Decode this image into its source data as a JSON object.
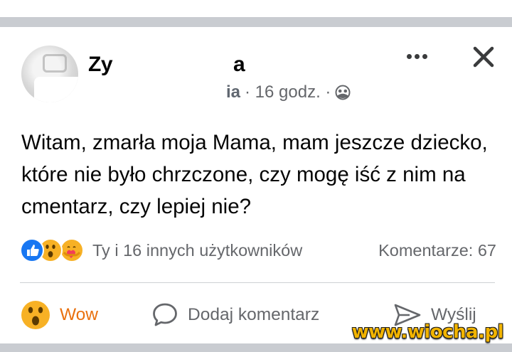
{
  "post": {
    "author_visible_fragment_left": "Zy",
    "author_visible_fragment_right": "a",
    "meta_fragment": "ia",
    "time": "· 16 godz. ·",
    "audience_icon": "group-icon",
    "text": "Witam, zmarła moja Mama, mam jeszcze dziecko, które nie było chrzczone, czy mogę iść z nim na cmentarz, czy lepiej nie?"
  },
  "header": {
    "more_icon": "more-dots-icon",
    "close_icon": "close-icon"
  },
  "reactions": {
    "icons": [
      "like-icon",
      "wow-icon",
      "care-icon"
    ],
    "summary": "Ty i 16 innych użytkowników",
    "comments": "Komentarze: 67"
  },
  "actions": {
    "wow_label": "Wow",
    "comment_label": "Dodaj komentarz",
    "send_label": "Wyślij"
  },
  "watermark": "www.wiocha.pl",
  "colors": {
    "primary_text": "#050505",
    "secondary_text": "#65676b",
    "like_blue": "#1877f2",
    "wow_orange": "#e9710f",
    "divider": "#ced0d4",
    "watermark_yellow": "#f2b400"
  }
}
